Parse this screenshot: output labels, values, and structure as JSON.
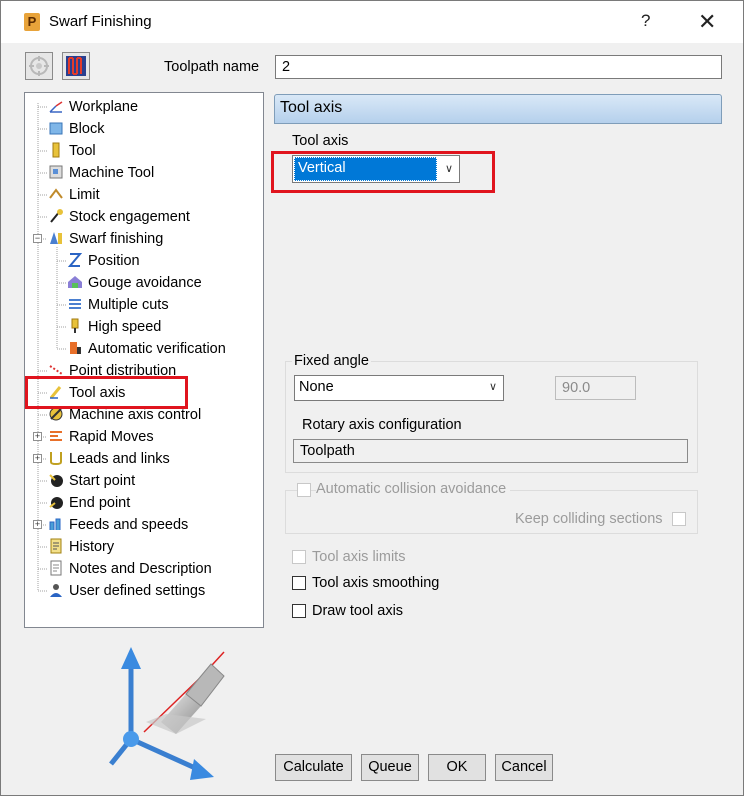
{
  "window": {
    "title": "Swarf Finishing",
    "help": "?",
    "close": "✕"
  },
  "toolpath": {
    "label": "Toolpath name",
    "value": "2"
  },
  "tree": {
    "items": [
      {
        "label": "Workplane"
      },
      {
        "label": "Block"
      },
      {
        "label": "Tool"
      },
      {
        "label": "Machine Tool"
      },
      {
        "label": "Limit"
      },
      {
        "label": "Stock engagement"
      },
      {
        "label": "Swarf finishing"
      },
      {
        "label": "Position"
      },
      {
        "label": "Gouge avoidance"
      },
      {
        "label": "Multiple cuts"
      },
      {
        "label": "High speed"
      },
      {
        "label": "Automatic verification"
      },
      {
        "label": "Point distribution"
      },
      {
        "label": "Tool axis"
      },
      {
        "label": "Machine axis control"
      },
      {
        "label": "Rapid Moves"
      },
      {
        "label": "Leads and links"
      },
      {
        "label": "Start point"
      },
      {
        "label": "End point"
      },
      {
        "label": "Feeds and speeds"
      },
      {
        "label": "History"
      },
      {
        "label": "Notes and Description"
      },
      {
        "label": "User defined settings"
      }
    ]
  },
  "panel": {
    "header": "Tool axis",
    "tool_axis_label": "Tool axis",
    "tool_axis_value": "Vertical",
    "fixed_angle": {
      "group_label": "Fixed angle",
      "select_value": "None",
      "angle_value": "90.0",
      "rotary_label": "Rotary axis configuration",
      "rotary_value": "Toolpath"
    },
    "collision": {
      "label": "Automatic collision avoidance",
      "keep_label": "Keep colliding sections"
    },
    "options": {
      "limits": "Tool axis limits",
      "smoothing": "Tool axis smoothing",
      "draw": "Draw tool axis"
    }
  },
  "buttons": {
    "calculate": "Calculate",
    "queue": "Queue",
    "ok": "OK",
    "cancel": "Cancel"
  },
  "colors": {
    "selection": "#0078d7",
    "highlight_red": "#e0141e",
    "header_blue": "#b5d0ec"
  }
}
